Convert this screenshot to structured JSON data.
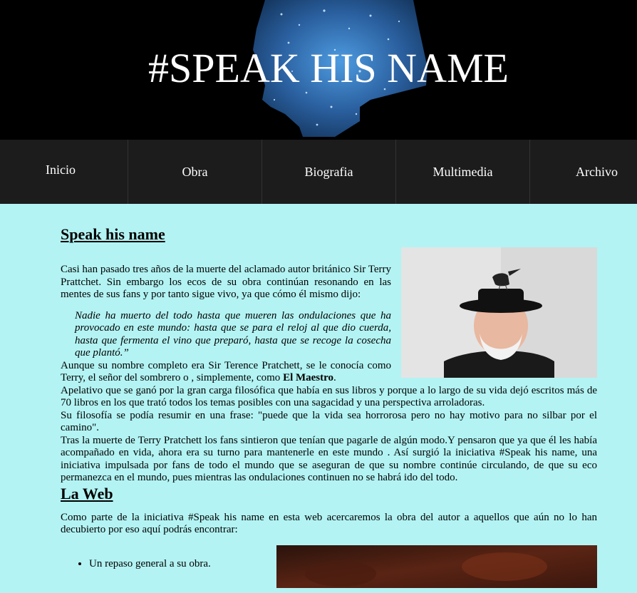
{
  "header": {
    "title": "#SPEAK HIS NAME",
    "background_color": "#000000",
    "art_color": "#2e6fb0"
  },
  "nav": {
    "items": [
      {
        "label": "Inicio"
      },
      {
        "label": "Obra"
      },
      {
        "label": "Biografia"
      },
      {
        "label": "Multimedia"
      },
      {
        "label": "Archivo"
      }
    ],
    "background_color": "#1c1c1c"
  },
  "main": {
    "background_color": "#b3f3f3",
    "section1": {
      "title": "Speak his name",
      "intro": "Casi han pasado tres años de la muerte del aclamado autor británico Sir Terry Prattchet. Sin embargo los ecos de su obra continúan resonando en las mentes de sus fans y por tanto sigue vivo, ya que cómo él mismo dijo:",
      "quote": "Nadie ha muerto del todo hasta que mueren las ondulaciones que ha provocado en este mundo: hasta que se para el reloj al que dio cuerda, hasta que fermenta el vino que preparó, hasta que se recoge la cosecha que plantó.”",
      "p2_before": "Aunque su nombre completo era Sir Terence Pratchett, se le conocía como Terry, el señor del sombrero o , simplemente, como ",
      "p2_bold": "El Maestro",
      "p2_after": ".",
      "p3": "Apelativo que se ganó por la gran carga filosófica que había en sus libros y porque a lo largo de su vida dejó escritos más de 70 libros en los que trató todos los temas posibles con una sagacidad y una perspectiva arroladoras.",
      "p4": "Su filosofía se podía resumir en una frase: \"puede que la vida sea horrorosa pero no hay motivo para no silbar por el camino\".",
      "p5": "Tras la muerte de Terry Pratchett los fans sintieron que tenían que pagarle de algún modo.Y pensaron que ya que él les había acompañado en vida, ahora era su turno para mantenerle en este mundo . Así surgió la iniciativa #Speak his name, una iniciativa impulsada por fans de todo el mundo que se aseguran de que su nombre continúe circulando, de que su eco permanezca en el mundo, pues mientras las ondulaciones continuen no se habrá ido del todo."
    },
    "section2": {
      "title": "La Web",
      "intro": "Como parte de la iniciativa #Speak his name en esta web acercaremos la obra del autor a aquellos que aún no lo han decubierto por eso aquí podrás encontrar:",
      "list": [
        "Un repaso general a su obra."
      ]
    }
  }
}
